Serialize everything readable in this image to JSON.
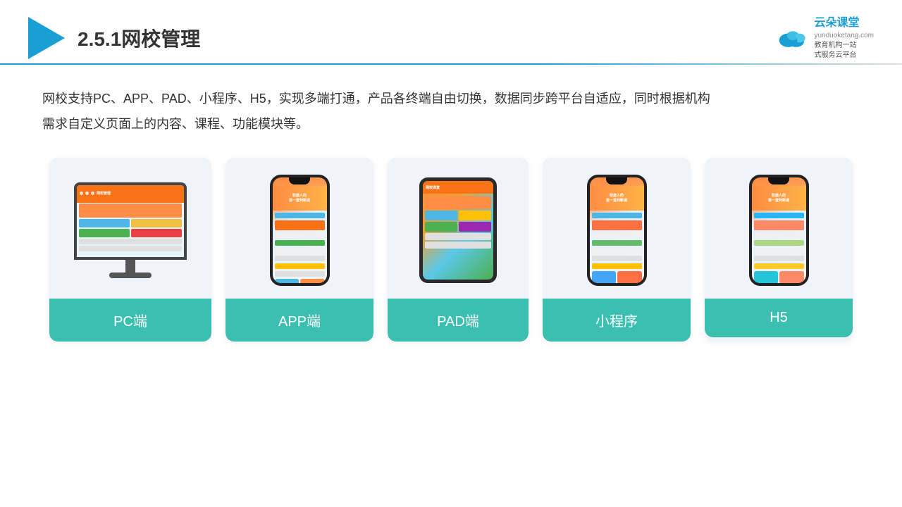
{
  "header": {
    "title": "2.5.1网校管理",
    "brand_name": "云朵课堂",
    "brand_url": "yunduoketang.com",
    "brand_subtitle": "教育机构一站\n式服务云平台"
  },
  "description": "网校支持PC、APP、PAD、小程序、H5，实现多端打通，产品各终端自由切换，数据同步跨平台自适应，同时根据机构\n需求自定义页面上的内容、课程、功能模块等。",
  "cards": [
    {
      "id": "pc",
      "label": "PC端"
    },
    {
      "id": "app",
      "label": "APP端"
    },
    {
      "id": "pad",
      "label": "PAD端"
    },
    {
      "id": "miniapp",
      "label": "小程序"
    },
    {
      "id": "h5",
      "label": "H5"
    }
  ],
  "colors": {
    "accent": "#1a9fd4",
    "teal": "#3abfb1",
    "orange": "#f97316",
    "text_dark": "#333333"
  },
  "phone_text": "职途人的\n第一堂判断课"
}
